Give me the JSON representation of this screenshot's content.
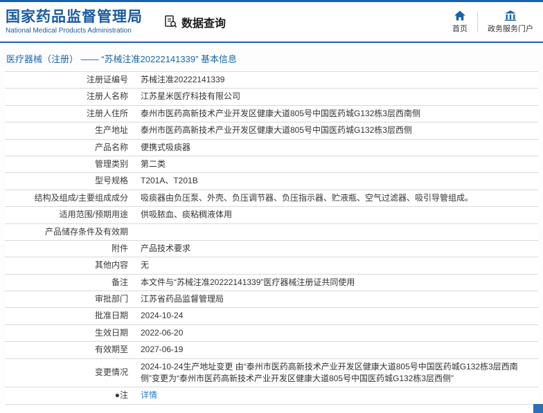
{
  "header": {
    "org_name_cn": "国家药品监督管理局",
    "org_name_en": "National Medical Products Administration",
    "tool_label": "数据查询",
    "nav_home": "首页",
    "nav_portal": "政务服务门户"
  },
  "page": {
    "title": "医疗器械（注册） —— “苏械注准20222141339” 基本信息"
  },
  "table": {
    "rows": [
      {
        "label": "注册证编号",
        "value": "苏械注准20222141339"
      },
      {
        "label": "注册人名称",
        "value": "江苏星米医疗科技有限公司"
      },
      {
        "label": "注册人住所",
        "value": "泰州市医药高新技术产业开发区健康大道805号中国医药城G132栋3层西南侧"
      },
      {
        "label": "生产地址",
        "value": "泰州市医药高新技术产业开发区健康大道805号中国医药城G132栋3层西侧"
      },
      {
        "label": "产品名称",
        "value": "便携式吸痰器"
      },
      {
        "label": "管理类别",
        "value": "第二类"
      },
      {
        "label": "型号规格",
        "value": "T201A、T201B"
      },
      {
        "label": "结构及组成/主要组成成分",
        "value": "吸痰器由负压泵、外壳、负压调节器、负压指示器、贮液瓶、空气过滤器、吸引导管组成。"
      },
      {
        "label": "适用范围/预期用途",
        "value": "供吸脓血、痰粘稠液体用"
      },
      {
        "label": "产品储存条件及有效期",
        "value": ""
      },
      {
        "label": "附件",
        "value": "产品技术要求"
      },
      {
        "label": "其他内容",
        "value": "无"
      },
      {
        "label": "备注",
        "value": "本文件与“苏械注准20222141339”医疗器械注册证共同使用"
      },
      {
        "label": "审批部门",
        "value": "江苏省药品监督管理局"
      },
      {
        "label": "批准日期",
        "value": "2024-10-24"
      },
      {
        "label": "生效日期",
        "value": "2022-06-20"
      },
      {
        "label": "有效期至",
        "value": "2027-06-19"
      },
      {
        "label": "变更情况",
        "value": "2024-10-24生产地址变更 由“泰州市医药高新技术产业开发区健康大道805号中国医药城G132栋3层西南侧”变更为“泰州市医药高新技术产业开发区健康大道805号中国医药城G132栋3层西侧”"
      },
      {
        "label": "●注",
        "value": "详情"
      }
    ]
  },
  "colors": {
    "brand_blue": "#1961ac",
    "link_blue": "#2a7bd3"
  }
}
